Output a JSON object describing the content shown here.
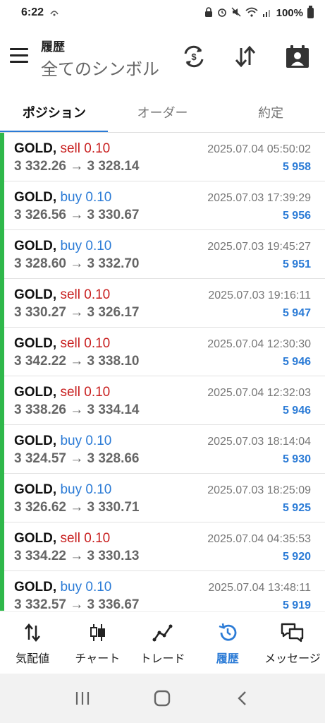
{
  "status_bar": {
    "time": "6:22",
    "battery": "100%"
  },
  "app_bar": {
    "title": "履歴",
    "subtitle": "全てのシンボル"
  },
  "tabs": [
    {
      "label": "ポジション",
      "active": true
    },
    {
      "label": "オーダー",
      "active": false
    },
    {
      "label": "約定",
      "active": false
    }
  ],
  "trades": [
    {
      "symbol": "GOLD,",
      "side": "sell",
      "volume": "0.10",
      "prices": "3 332.26 → 3 328.14",
      "date": "2025.07.04 05:50:02",
      "ticket": "5 958"
    },
    {
      "symbol": "GOLD,",
      "side": "buy",
      "volume": "0.10",
      "prices": "3 326.56 → 3 330.67",
      "date": "2025.07.03 17:39:29",
      "ticket": "5 956"
    },
    {
      "symbol": "GOLD,",
      "side": "buy",
      "volume": "0.10",
      "prices": "3 328.60 → 3 332.70",
      "date": "2025.07.03 19:45:27",
      "ticket": "5 951"
    },
    {
      "symbol": "GOLD,",
      "side": "sell",
      "volume": "0.10",
      "prices": "3 330.27 → 3 326.17",
      "date": "2025.07.03 19:16:11",
      "ticket": "5 947"
    },
    {
      "symbol": "GOLD,",
      "side": "sell",
      "volume": "0.10",
      "prices": "3 342.22 → 3 338.10",
      "date": "2025.07.04 12:30:30",
      "ticket": "5 946"
    },
    {
      "symbol": "GOLD,",
      "side": "sell",
      "volume": "0.10",
      "prices": "3 338.26 → 3 334.14",
      "date": "2025.07.04 12:32:03",
      "ticket": "5 946"
    },
    {
      "symbol": "GOLD,",
      "side": "buy",
      "volume": "0.10",
      "prices": "3 324.57 → 3 328.66",
      "date": "2025.07.03 18:14:04",
      "ticket": "5 930"
    },
    {
      "symbol": "GOLD,",
      "side": "buy",
      "volume": "0.10",
      "prices": "3 326.62 → 3 330.71",
      "date": "2025.07.03 18:25:09",
      "ticket": "5 925"
    },
    {
      "symbol": "GOLD,",
      "side": "sell",
      "volume": "0.10",
      "prices": "3 334.22 → 3 330.13",
      "date": "2025.07.04 04:35:53",
      "ticket": "5 920"
    },
    {
      "symbol": "GOLD,",
      "side": "buy",
      "volume": "0.10",
      "prices": "3 332.57 → 3 336.67",
      "date": "2025.07.04 13:48:11",
      "ticket": "5 919"
    }
  ],
  "bottom_nav": [
    {
      "label": "気配値",
      "icon": "quotes-arrows-icon",
      "active": false
    },
    {
      "label": "チャート",
      "icon": "candlestick-icon",
      "active": false
    },
    {
      "label": "トレード",
      "icon": "trade-line-icon",
      "active": false
    },
    {
      "label": "履歴",
      "icon": "history-clock-icon",
      "active": true
    },
    {
      "label": "メッセージ",
      "icon": "messages-icon",
      "active": false
    }
  ],
  "colors": {
    "accent_blue": "#2b7bd6",
    "sell_red": "#c81e1e",
    "position_green": "#2fb84a"
  }
}
